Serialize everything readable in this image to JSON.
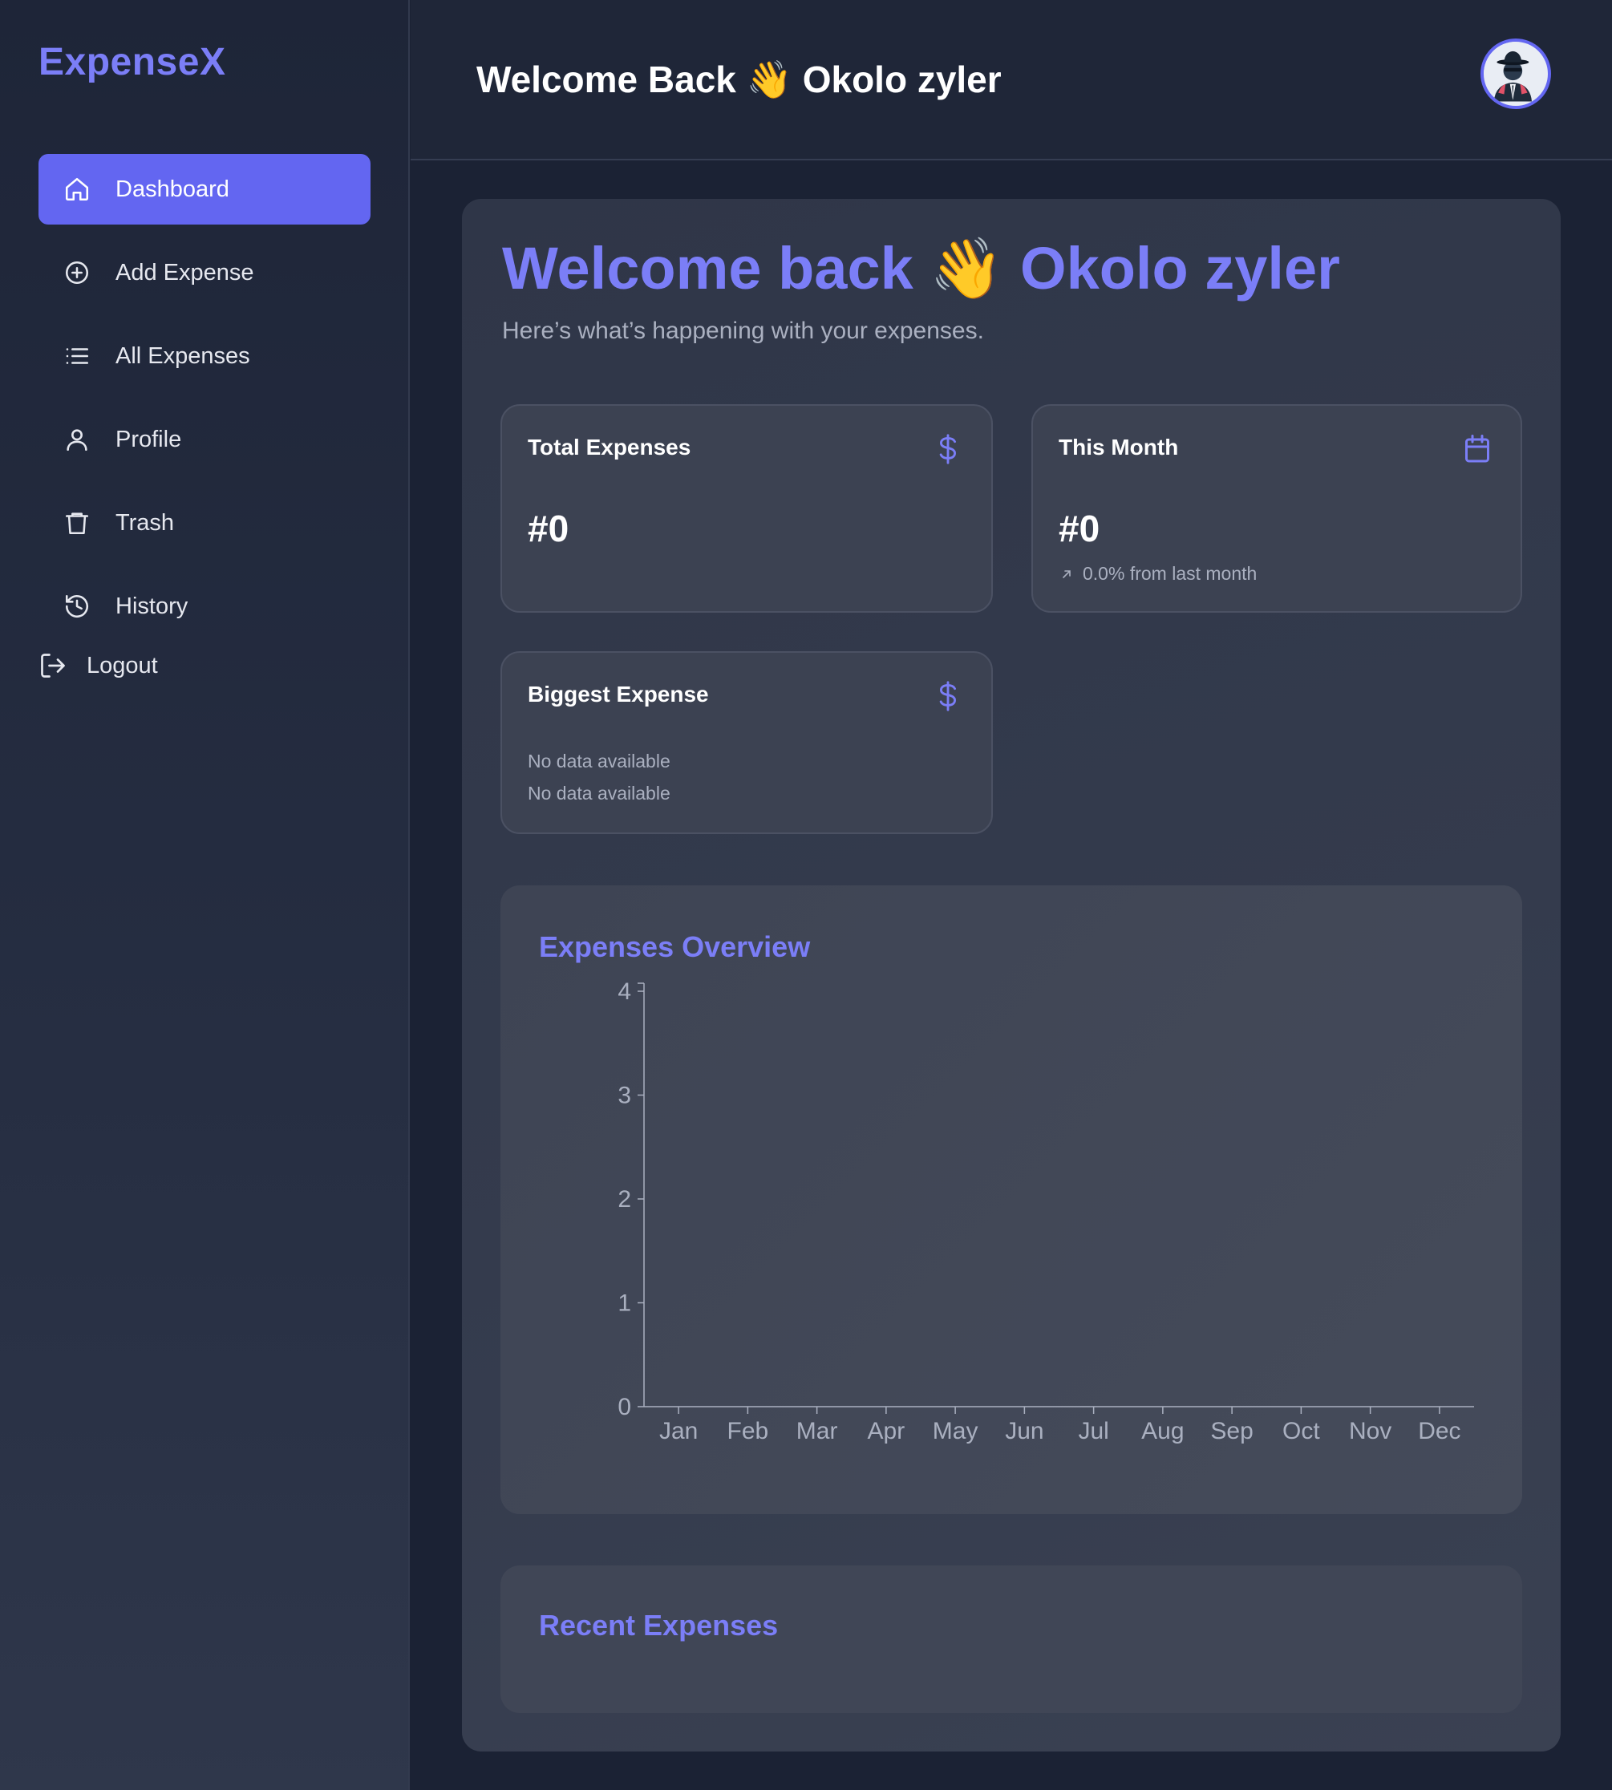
{
  "brand": "ExpenseX",
  "sidebar": {
    "items": [
      {
        "label": "Dashboard",
        "icon": "home-icon",
        "active": true
      },
      {
        "label": "Add Expense",
        "icon": "plus-circle-icon"
      },
      {
        "label": "All Expenses",
        "icon": "list-icon"
      },
      {
        "label": "Profile",
        "icon": "user-icon"
      },
      {
        "label": "Trash",
        "icon": "trash-icon"
      },
      {
        "label": "History",
        "icon": "history-icon"
      }
    ],
    "logout_label": "Logout"
  },
  "header": {
    "title": "Welcome Back 👋 Okolo zyler",
    "avatar_icon": "spy-avatar-icon"
  },
  "main": {
    "welcome": "Welcome back 👋 Okolo zyler",
    "subtitle": "Here’s what’s happening with your expenses.",
    "cards": {
      "total": {
        "title": "Total Expenses",
        "value": "#0",
        "icon": "dollar-icon"
      },
      "month": {
        "title": "This Month",
        "value": "#0",
        "change": "0.0% from last month",
        "icon": "calendar-icon"
      },
      "biggest": {
        "title": "Biggest Expense",
        "line1": "No data available",
        "line2": "No data available",
        "icon": "dollar-icon"
      }
    },
    "recent_title": "Recent Expenses"
  },
  "colors": {
    "accent": "#6366f1",
    "accent_text": "#7b7ef7",
    "background": "#1b2234"
  },
  "chart_data": {
    "type": "bar",
    "title": "Expenses Overview",
    "categories": [
      "Jan",
      "Feb",
      "Mar",
      "Apr",
      "May",
      "Jun",
      "Jul",
      "Aug",
      "Sep",
      "Oct",
      "Nov",
      "Dec"
    ],
    "values": [
      0,
      0,
      0,
      0,
      0,
      0,
      0,
      0,
      0,
      0,
      0,
      0
    ],
    "y_ticks": [
      0,
      1,
      2,
      3,
      4
    ],
    "ylim": [
      0,
      4
    ],
    "xlabel": "",
    "ylabel": "",
    "grid": false
  }
}
